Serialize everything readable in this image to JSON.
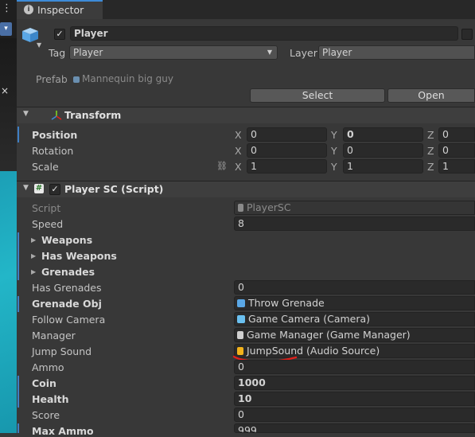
{
  "tab": {
    "label": "Inspector"
  },
  "header": {
    "name": "Player",
    "tag_label": "Tag",
    "tag_value": "Player",
    "layer_label": "Layer",
    "layer_value": "Player",
    "prefab_label": "Prefab",
    "prefab_value": "Mannequin big guy",
    "select_label": "Select",
    "open_label": "Open"
  },
  "transform": {
    "title": "Transform",
    "position_label": "Position",
    "rotation_label": "Rotation",
    "scale_label": "Scale",
    "position": {
      "x": "0",
      "y": "0",
      "z": "0"
    },
    "rotation": {
      "x": "0",
      "y": "0",
      "z": "0"
    },
    "scale": {
      "x": "1",
      "y": "1",
      "z": "1"
    },
    "axis_x": "X",
    "axis_y": "Y",
    "axis_z": "Z"
  },
  "script_component": {
    "title": "Player SC (Script)",
    "script_label": "Script",
    "script_value": "PlayerSC",
    "speed_label": "Speed",
    "speed_value": "8",
    "weapons_label": "Weapons",
    "has_weapons_label": "Has Weapons",
    "grenades_label": "Grenades",
    "has_grenades_label": "Has Grenades",
    "has_grenades_value": "0",
    "grenade_obj_label": "Grenade Obj",
    "grenade_obj_value": "Throw Grenade",
    "follow_camera_label": "Follow Camera",
    "follow_camera_value": "Game Camera (Camera)",
    "manager_label": "Manager",
    "manager_value": "Game Manager (Game Manager)",
    "jump_sound_label": "Jump Sound",
    "jump_sound_value": "JumpSound (Audio Source)",
    "ammo_label": "Ammo",
    "ammo_value": "0",
    "coin_label": "Coin",
    "coin_value": "1000",
    "health_label": "Health",
    "health_value": "10",
    "score_label": "Score",
    "score_value": "0",
    "max_ammo_label": "Max Ammo",
    "max_ammo_value": "999"
  },
  "colors": {
    "accent": "#3d8bd8",
    "annotation_red": "#e0201b",
    "audio_icon": "#f2b21b"
  }
}
